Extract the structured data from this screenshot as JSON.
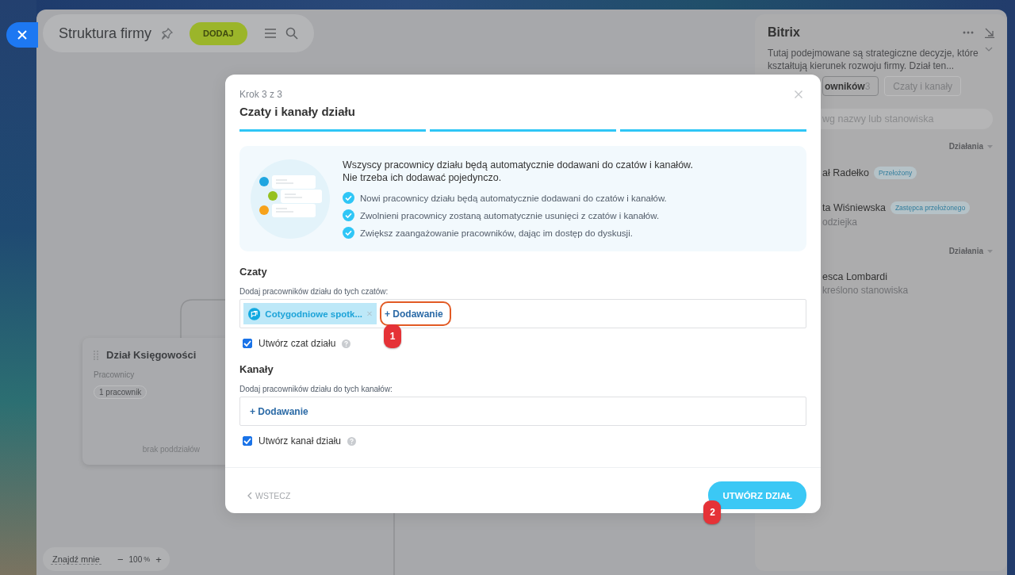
{
  "toolbar": {
    "title": "Struktura firmy",
    "add_button": "DODAJ"
  },
  "department_card": {
    "title": "Dział Księgowości",
    "employees_label": "Pracownicy",
    "employee_count": "1 pracownik",
    "subdepartments": "brak poddziałów"
  },
  "zoom_bar": {
    "find_me": "Znajdź mnie",
    "minus": "−",
    "zoom": "100",
    "unit": "%",
    "plus": "+"
  },
  "side_panel": {
    "title": "Bitrix",
    "description": "Tutaj podejmowane są strategiczne decyzje, które\nkształtują kierunek rozwoju firmy. Dział ten...",
    "tabs": [
      {
        "label": "owników",
        "count": "3",
        "selected": true
      },
      {
        "label": "Czaty i kanały",
        "selected": false
      }
    ],
    "search": {
      "placeholder": "wg nazwy lub stanowiska"
    },
    "groups": [
      {
        "actions": "Działania",
        "members": [
          {
            "name": "ał Radełko",
            "badge": "Przełożony"
          },
          {
            "name": "ta Wiśniewska",
            "badge": "Zastępca przełożonego",
            "position": "odziejka"
          }
        ]
      },
      {
        "actions": "Działania",
        "members": [
          {
            "name": "esca Lombardi",
            "position": "kreślono stanowiska"
          }
        ]
      }
    ]
  },
  "modal": {
    "step": "Krok 3 z 3",
    "title": "Czaty i kanały działu",
    "progress": [
      {
        "done": true
      },
      {
        "done": true
      },
      {
        "done": true
      }
    ],
    "info": {
      "headline": "Wszyscy pracownicy działu będą automatycznie dodawani do czatów i kanałów.\nNie trzeba ich dodawać pojedynczo.",
      "points": [
        "Nowi pracownicy działu będą automatycznie dodawani do czatów i kanałów.",
        "Zwolnieni pracownicy zostaną automatycznie usunięci z czatów i kanałów.",
        "Zwiększ zaangażowanie pracowników, dając im dostęp do dyskusji."
      ]
    },
    "sections": [
      {
        "title": "Czaty",
        "field_label": "Dodaj pracowników działu do tych czatów:",
        "chips": [
          {
            "label": "Cotygodniowe spotk..."
          }
        ],
        "add_button": {
          "label": "+ Dodawanie",
          "highlighted": true,
          "annotation": "1"
        },
        "checkbox": {
          "label": "Utwórz czat działu",
          "checked": true
        }
      },
      {
        "title": "Kanały",
        "field_label": "Dodaj pracowników działu do tych kanałów:",
        "add_button": {
          "label": "+ Dodawanie",
          "highlighted": false
        },
        "checkbox": {
          "label": "Utwórz kanał działu",
          "checked": true
        }
      }
    ],
    "back_button": "WSTECZ",
    "submit_button": {
      "label": "UTWÓRZ DZIAŁ",
      "annotation": "2"
    }
  }
}
